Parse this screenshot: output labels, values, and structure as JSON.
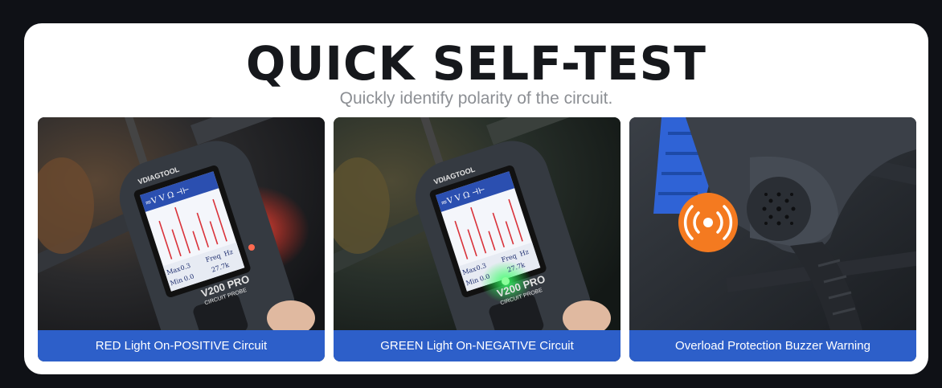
{
  "header": {
    "title": "QUICK SELF-TEST",
    "subtitle": "Quickly identify polarity of the circuit."
  },
  "panels": [
    {
      "caption": "RED Light On-POSITIVE Circuit",
      "led_color": "#ff3b2f",
      "brand": "VDIAGTOOL",
      "model": "V200 PRO",
      "model_sub": "CIRCUIT PROBE",
      "screen": {
        "modes": "≂V V Ω ⊣⊢",
        "max_label": "Max",
        "max_value": "0.3",
        "min_label": "Min",
        "min_value": "0.0",
        "freq_label": "Freq",
        "freq_unit": "Hz",
        "freq_value": "27.7k"
      }
    },
    {
      "caption": "GREEN Light On-NEGATIVE Circuit",
      "led_color": "#2fff5a",
      "brand": "VDIAGTOOL",
      "model": "V200 PRO",
      "model_sub": "CIRCUIT PROBE",
      "screen": {
        "modes": "≂V V Ω ⊣⊢",
        "max_label": "Max",
        "max_value": "0.3",
        "min_label": "Min",
        "min_value": "0.0",
        "freq_label": "Freq",
        "freq_unit": "Hz",
        "freq_value": "27.7k"
      }
    },
    {
      "caption": "Overload Protection Buzzer Warning",
      "icon": "buzzer-sound-icon",
      "accent": "#f47a20"
    }
  ],
  "colors": {
    "caption_bg": "#2d5fc9",
    "card_bg": "#ffffff",
    "page_bg": "#0f1116"
  }
}
